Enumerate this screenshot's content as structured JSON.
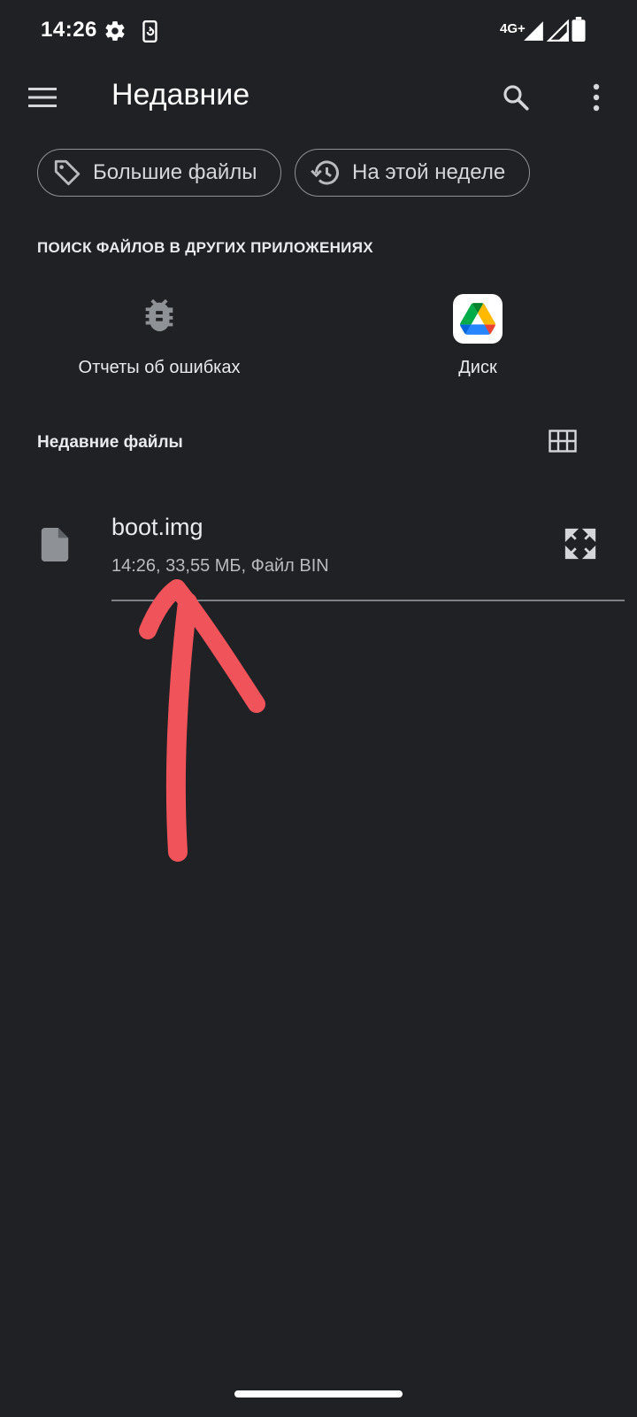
{
  "status_bar": {
    "time": "14:26",
    "network": "4G+",
    "icons": [
      "gear-icon",
      "phone-sync-icon",
      "signal-icon",
      "signal-icon",
      "battery-icon"
    ]
  },
  "app_bar": {
    "title": "Недавние",
    "icons": [
      "menu-icon",
      "search-icon",
      "more-vert-icon"
    ]
  },
  "chips": [
    {
      "label": "Большие файлы",
      "icon": "tag-icon"
    },
    {
      "label": "На этой неделе",
      "icon": "history-icon"
    }
  ],
  "other_apps": {
    "caption": "ПОИСК ФАЙЛОВ В ДРУГИХ ПРИЛОЖЕНИЯХ",
    "items": [
      {
        "label": "Отчеты об ошибках",
        "icon": "bug-icon"
      },
      {
        "label": "Диск",
        "icon": "google-drive-icon"
      }
    ]
  },
  "recent": {
    "title": "Недавние файлы",
    "view_icon": "grid-view-icon",
    "files": [
      {
        "name": "boot.img",
        "meta": "14:26, 33,55 МБ, Файл BIN",
        "icon": "file-icon",
        "action_icon": "expand-icon"
      }
    ]
  },
  "colors": {
    "background": "#202124",
    "text": "#e8eaed",
    "annotation": "#f0535a"
  }
}
